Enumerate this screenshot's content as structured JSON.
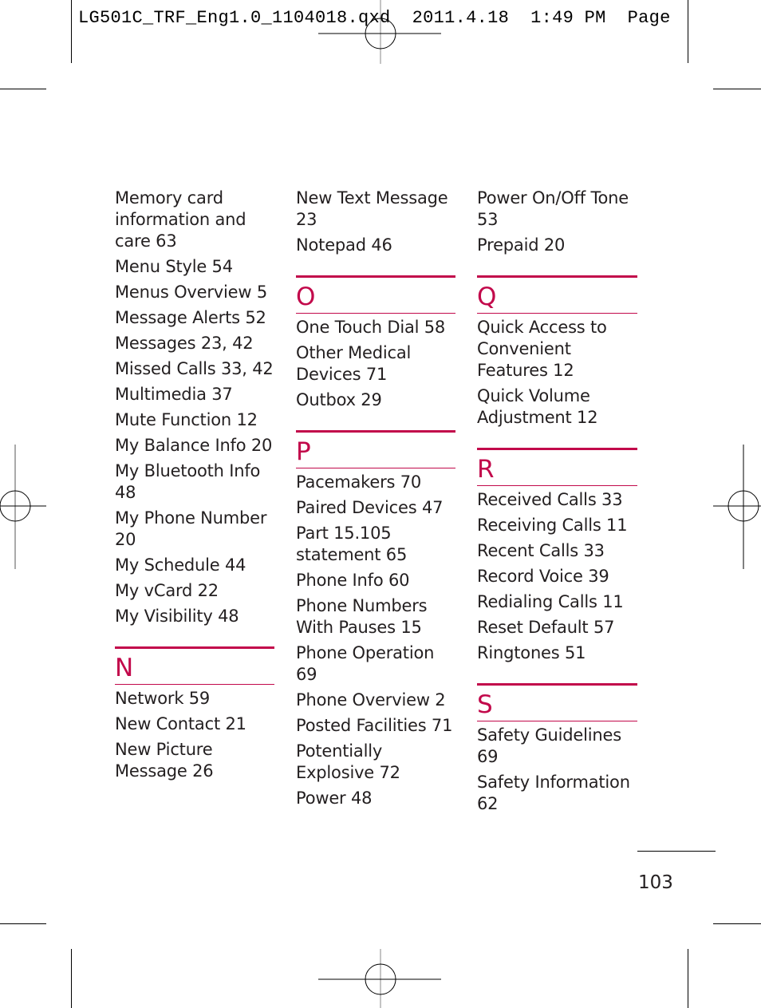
{
  "slug_line": "LG501C_TRF_Eng1.0_1104018.qxd  2011.4.18  1:49 PM  Page",
  "page_number": "103",
  "accent_color": "#c2094b",
  "columns": [
    {
      "lead_entries": [
        "Memory card information and care 63",
        "Menu Style 54",
        "Menus Overview 5",
        "Message Alerts 52",
        "Messages 23, 42",
        "Missed Calls 33, 42",
        "Multimedia 37",
        "Mute Function 12",
        "My Balance Info 20",
        "My Bluetooth Info 48",
        "My Phone Number 20",
        "My Schedule 44",
        "My vCard 22",
        "My Visibility 48"
      ],
      "sections": [
        {
          "letter": "N",
          "entries": [
            "Network 59",
            "New Contact 21",
            "New Picture Message 26"
          ]
        }
      ]
    },
    {
      "lead_entries": [
        "New Text Message 23",
        "Notepad 46"
      ],
      "sections": [
        {
          "letter": "O",
          "entries": [
            "One Touch Dial 58",
            "Other Medical Devices 71",
            "Outbox 29"
          ]
        },
        {
          "letter": "P",
          "entries": [
            "Pacemakers 70",
            "Paired Devices 47",
            "Part 15.105 statement 65",
            "Phone Info 60",
            "Phone Numbers With Pauses 15",
            "Phone Operation 69",
            "Phone Overview 2",
            "Posted Facilities 71",
            "Potentially Explosive 72",
            "Power 48"
          ]
        }
      ]
    },
    {
      "lead_entries": [
        "Power On/Off Tone 53",
        "Prepaid 20"
      ],
      "sections": [
        {
          "letter": "Q",
          "entries": [
            "Quick Access to Convenient Features 12",
            "Quick Volume Adjustment 12"
          ]
        },
        {
          "letter": "R",
          "entries": [
            "Received Calls 33",
            "Receiving Calls 11",
            "Recent Calls 33",
            "Record Voice 39",
            "Redialing Calls 11",
            "Reset Default 57",
            "Ringtones 51"
          ]
        },
        {
          "letter": "S",
          "entries": [
            "Safety Guidelines 69",
            "Safety Information 62"
          ]
        }
      ]
    }
  ]
}
